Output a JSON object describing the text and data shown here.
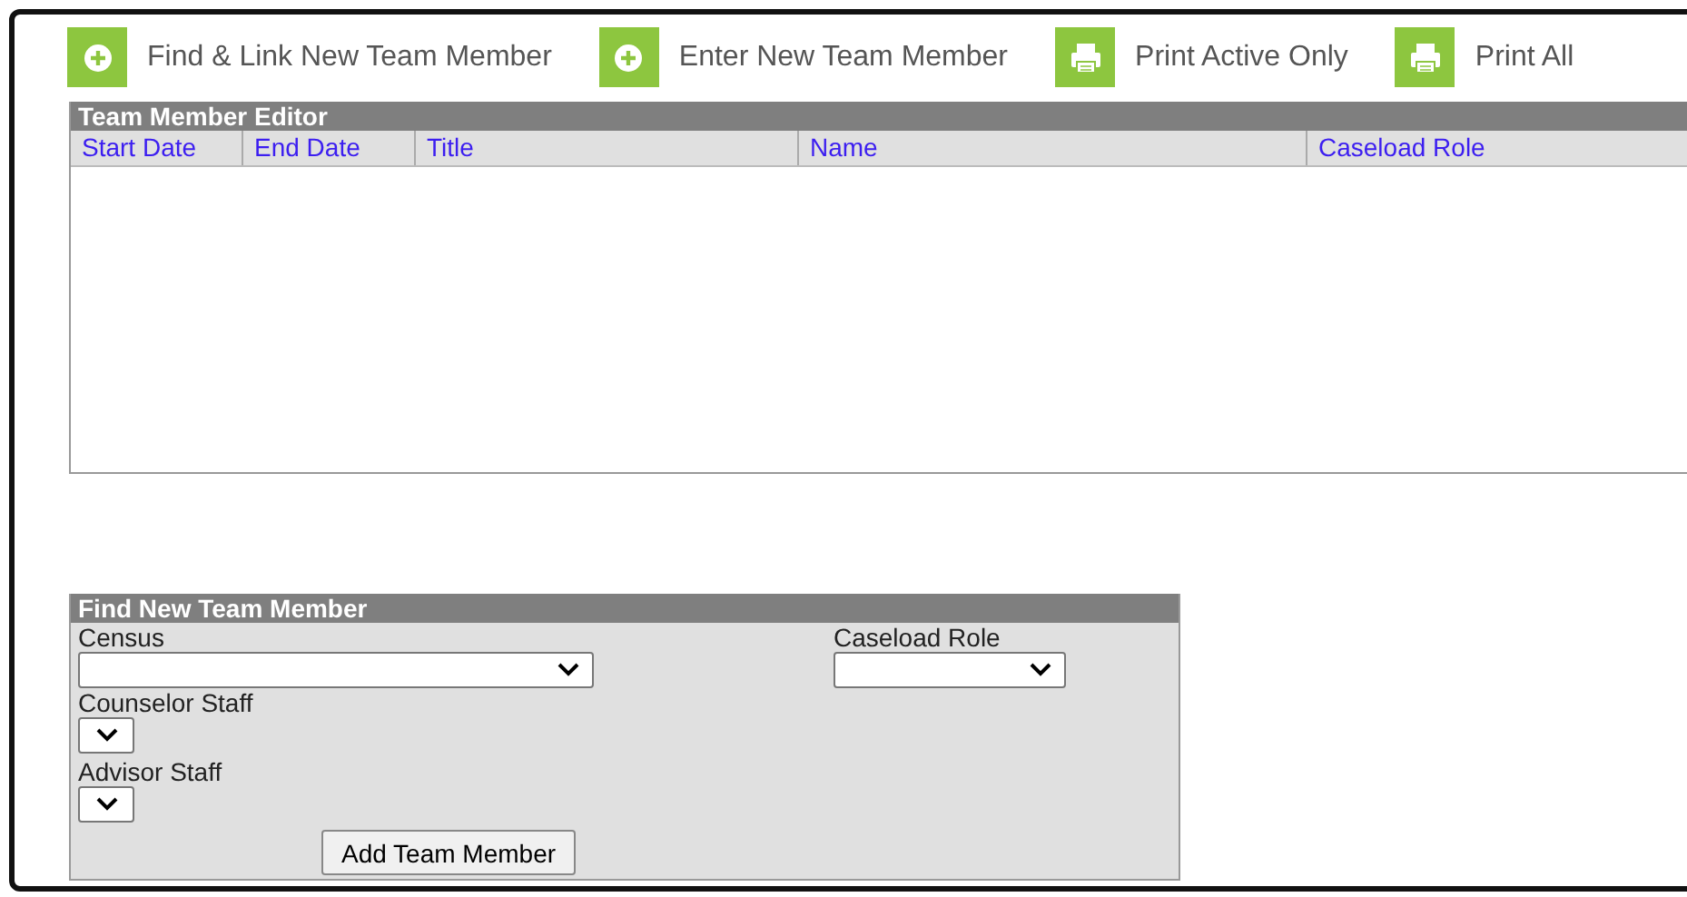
{
  "toolbar": [
    {
      "label": "Find & Link New Team Member",
      "kind": "add"
    },
    {
      "label": "Enter New Team Member",
      "kind": "add"
    },
    {
      "label": "Print Active Only",
      "kind": "print"
    },
    {
      "label": "Print All",
      "kind": "print"
    }
  ],
  "editor": {
    "title": "Team Member Editor",
    "columns": [
      "Start Date",
      "End Date",
      "Title",
      "Name",
      "Caseload Role"
    ]
  },
  "find": {
    "title": "Find New Team Member",
    "census": {
      "label": "Census"
    },
    "caseload_role": {
      "label": "Caseload Role"
    },
    "counselor_staff": {
      "label": "Counselor Staff"
    },
    "advisor_staff": {
      "label": "Advisor Staff"
    },
    "button": "Add Team Member"
  }
}
